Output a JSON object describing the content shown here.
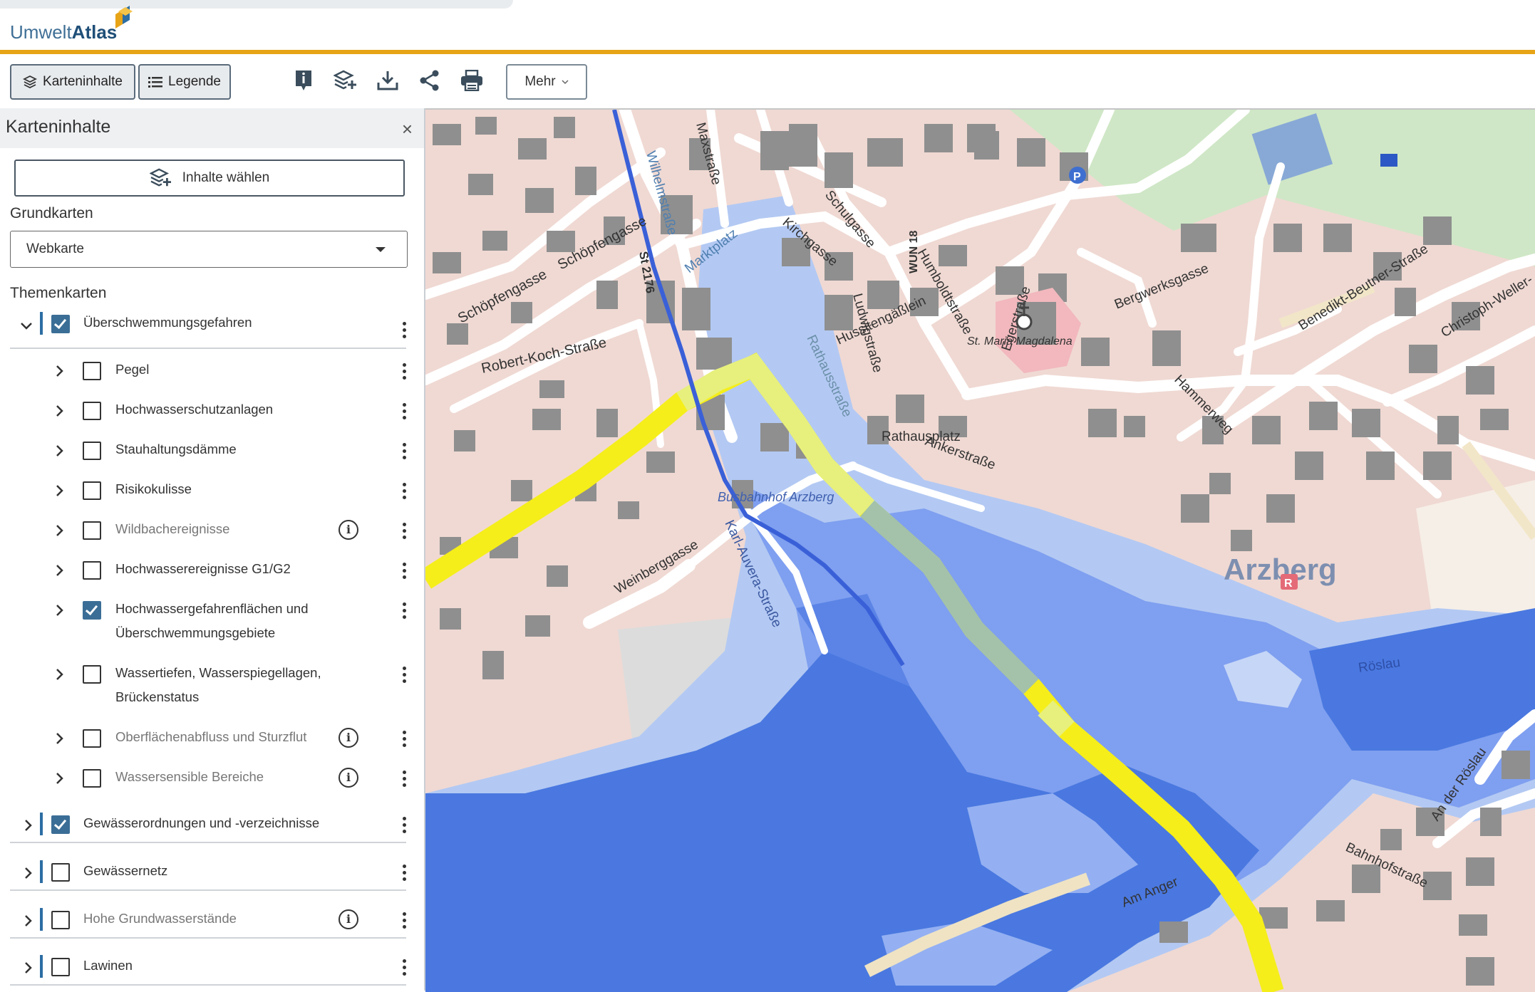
{
  "app": {
    "logo_part1": "Umwelt",
    "logo_part2": "Atlas",
    "accent_color": "#e8a417"
  },
  "toolbar": {
    "karteninhalte_label": "Karteninhalte",
    "legende_label": "Legende",
    "mehr_label": "Mehr",
    "icons": [
      "info-icon",
      "add-layers-icon",
      "download-icon",
      "share-icon",
      "print-icon"
    ]
  },
  "sidebar": {
    "title": "Karteninhalte",
    "close_symbol": "×",
    "choose_button": "Inhalte wählen",
    "grundkarten_label": "Grundkarten",
    "basemap_selected": "Webkarte",
    "themenkarten_label": "Themenkarten",
    "groups": [
      {
        "label": "Überschwemmungsgefahren",
        "checked": true,
        "expanded": true
      },
      {
        "label": "Gewässerordnungen und -verzeichnisse",
        "checked": true,
        "expanded": false
      },
      {
        "label": "Gewässernetz",
        "checked": false,
        "expanded": false
      },
      {
        "label": "Hohe Grundwasserstände",
        "checked": false,
        "expanded": false,
        "info": true
      },
      {
        "label": "Lawinen",
        "checked": false,
        "expanded": false
      }
    ],
    "layers": [
      {
        "label": "Pegel",
        "checked": false
      },
      {
        "label": "Hochwasserschutzanlagen",
        "checked": false
      },
      {
        "label": "Stauhaltungsdämme",
        "checked": false
      },
      {
        "label": "Risikokulisse",
        "checked": false
      },
      {
        "label": "Wildbachereignisse",
        "checked": false,
        "info": true,
        "muted": true
      },
      {
        "label": "Hochwasserereignisse G1/G2",
        "checked": false
      },
      {
        "label_line1": "Hochwassergefahrenflächen und",
        "label_line2": "Überschwemmungsgebiete",
        "checked": true
      },
      {
        "label_line1": "Wassertiefen, Wasserspiegellagen,",
        "label_line2": "Brückenstatus",
        "checked": false
      },
      {
        "label": "Oberflächenabfluss und Sturzflut",
        "checked": false,
        "info": true,
        "muted": true
      },
      {
        "label": "Wassersensible Bereiche",
        "checked": false,
        "info": true,
        "muted": true
      }
    ]
  },
  "map": {
    "town_label": "Arzberg",
    "streets": [
      "Schöpfengasse",
      "Schöpfengasse",
      "Robert-Koch-Straße",
      "Wilhelmstraße",
      "Maxstraße",
      "Marktplatz",
      "Kirchgasse",
      "Schulgasse",
      "Humboldtstraße",
      "Egerstraße",
      "Bergwerksgasse",
      "Benedikt-Beutner-Straße",
      "Christoph-Weller-",
      "Ludwigstraße",
      "Hussitengäßlein",
      "Rathausstraße",
      "Rathausplatz",
      "Ankerstraße",
      "Hammerweg",
      "Weinberggasse",
      "Karl-Auvera-Straße",
      "Bahnhofstraße",
      "Am Anger",
      "An der Röslau",
      "Röslau",
      "St 2176",
      "WUN 18"
    ],
    "poi": [
      "St. Maria Magdalena",
      "Busbahnhof Arzberg"
    ],
    "colors": {
      "flood_deep": "#4a78e0",
      "flood_mid": "#6c93ee",
      "flood_light": "#aac3f5",
      "road_major": "#f5ee1a",
      "building": "#8f8f8f",
      "settlement": "#f0d9d3"
    }
  }
}
